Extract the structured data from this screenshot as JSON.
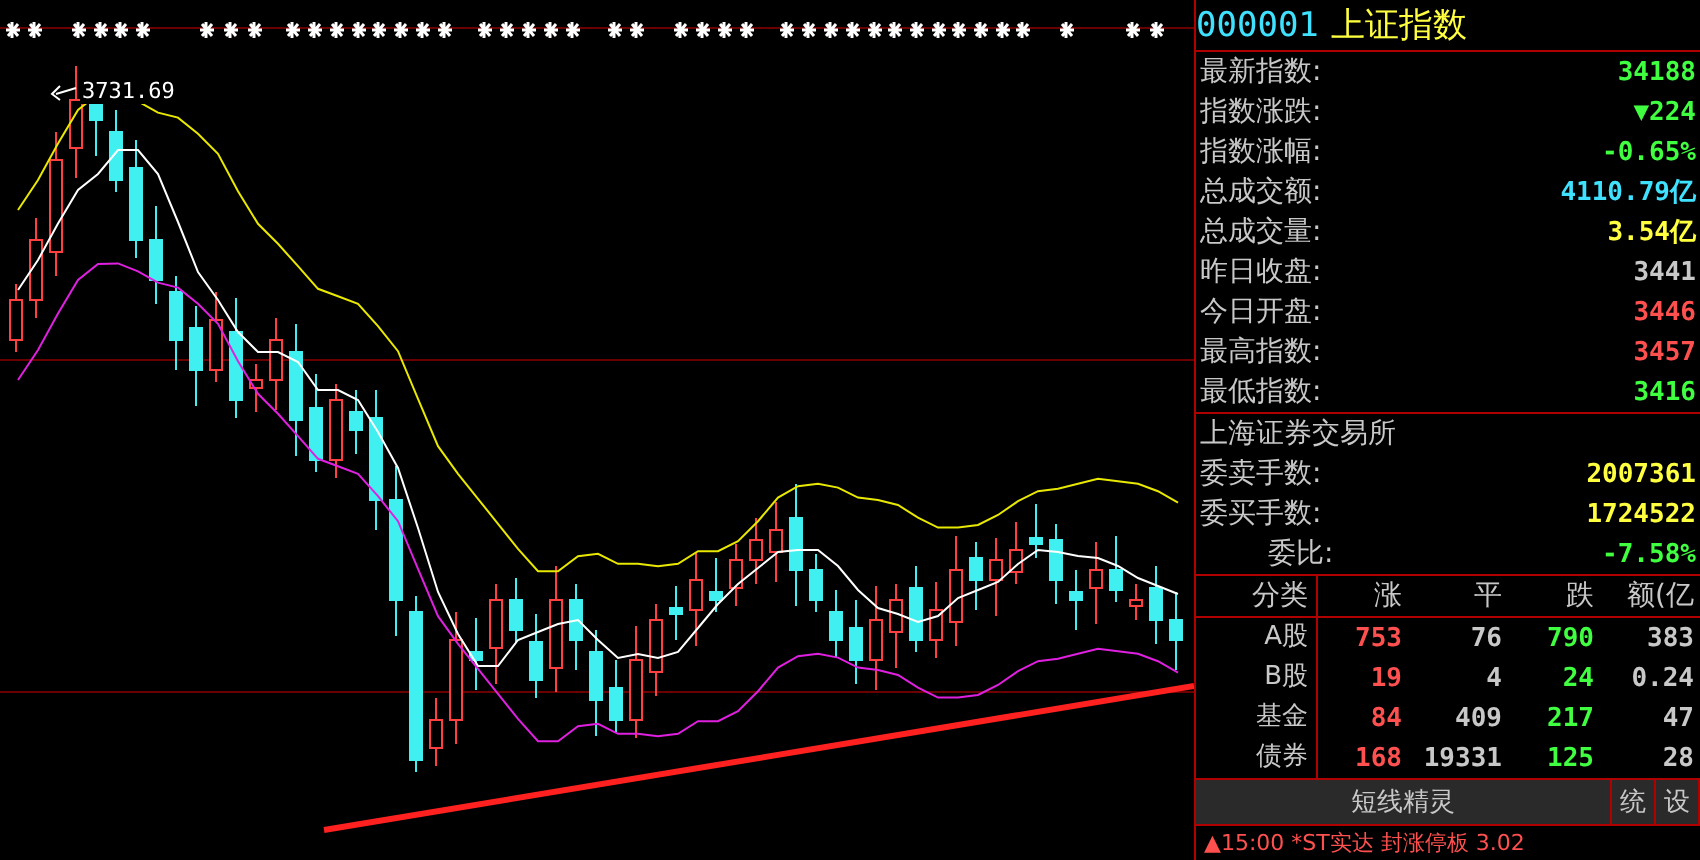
{
  "chart": {
    "high_label": "3731.69"
  },
  "quote": {
    "code": "000001",
    "name": "上证指数"
  },
  "stats": [
    {
      "label": "最新指数:",
      "value": "34188",
      "color": "#40ff40"
    },
    {
      "label": "指数涨跌:",
      "value": "▼224",
      "color": "#40ff40"
    },
    {
      "label": "指数涨幅:",
      "value": "-0.65%",
      "color": "#40ff40"
    },
    {
      "label": "总成交额:",
      "value": "4110.79亿",
      "color": "#40e0ff"
    },
    {
      "label": "总成交量:",
      "value": "3.54亿",
      "color": "#ffff40"
    },
    {
      "label": "昨日收盘:",
      "value": "3441",
      "color": "#c8c8c8"
    },
    {
      "label": "今日开盘:",
      "value": "3446",
      "color": "#ff5050"
    },
    {
      "label": "最高指数:",
      "value": "3457",
      "color": "#ff5050"
    },
    {
      "label": "最低指数:",
      "value": "3416",
      "color": "#40ff40"
    }
  ],
  "exchange": "上海证券交易所",
  "orders": [
    {
      "label": "委卖手数:",
      "value": "2007361",
      "color": "#ffff40"
    },
    {
      "label": "委买手数:",
      "value": "1724522",
      "color": "#ffff40"
    },
    {
      "label": "委比:",
      "value": "-7.58%",
      "color": "#40ff40"
    }
  ],
  "breadth": {
    "columns": [
      "分类",
      "涨",
      "平",
      "跌",
      "额(亿"
    ],
    "rows": [
      [
        "A股",
        "753",
        "76",
        "790",
        "383"
      ],
      [
        "B股",
        "19",
        "4",
        "24",
        "0.24"
      ],
      [
        "基金",
        "84",
        "409",
        "217",
        "47"
      ],
      [
        "债券",
        "168",
        "19331",
        "125",
        "28"
      ]
    ]
  },
  "toolbar": {
    "title": "短线精灵",
    "buttons": [
      "统",
      "设"
    ]
  },
  "ticker": "▲15:00 *ST实达 封涨停板 3.02"
}
